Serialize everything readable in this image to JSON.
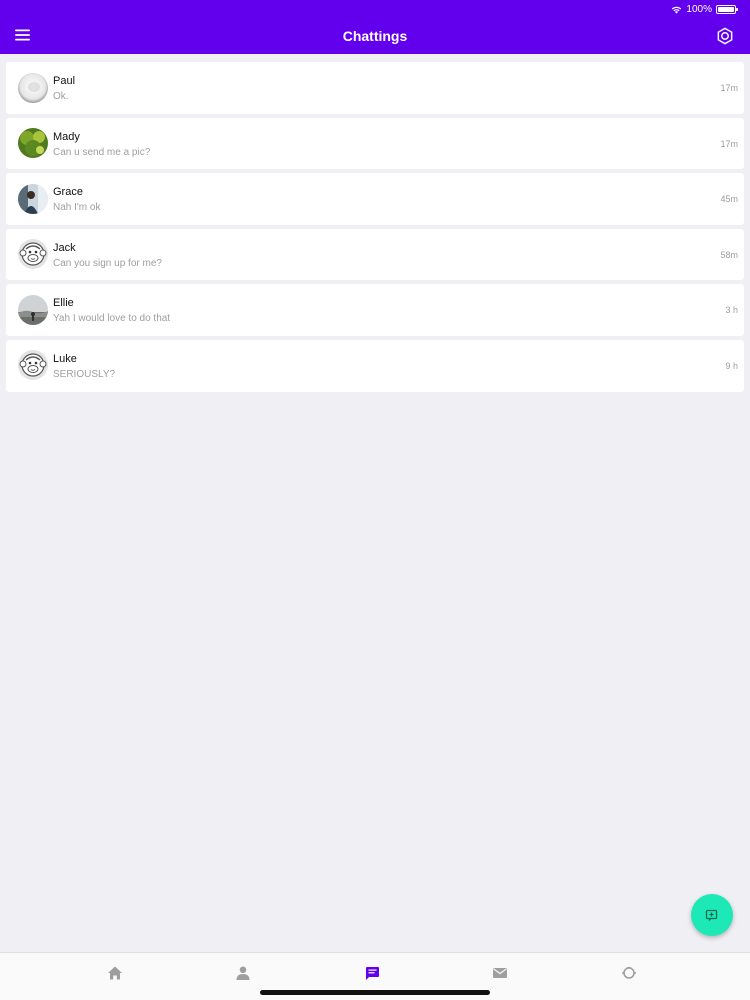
{
  "status_bar": {
    "battery_text": "100%"
  },
  "header": {
    "title": "Chattings",
    "background": "#6200ee",
    "menu_icon": "menu-icon",
    "settings_icon": "gear-icon"
  },
  "chats": [
    {
      "name": "Paul",
      "message": "Ok.",
      "time": "17m",
      "avatar": "photo-white"
    },
    {
      "name": "Mady",
      "message": "Can u send me a pic?",
      "time": "17m",
      "avatar": "photo-plant"
    },
    {
      "name": "Grace",
      "message": "Nah I'm ok",
      "time": "45m",
      "avatar": "photo-person"
    },
    {
      "name": "Jack",
      "message": "Can you sign up for me?",
      "time": "58m",
      "avatar": "default-monkey"
    },
    {
      "name": "Ellie",
      "message": "Yah I would love to do that",
      "time": "3 h",
      "avatar": "photo-outdoor"
    },
    {
      "name": "Luke",
      "message": "SERIOUSLY?",
      "time": "9 h",
      "avatar": "default-monkey"
    }
  ],
  "fab": {
    "icon": "new-chat-icon",
    "color": "#1de9b6"
  },
  "tabs": [
    {
      "icon": "home-icon",
      "active": false
    },
    {
      "icon": "person-icon",
      "active": false
    },
    {
      "icon": "chat-icon",
      "active": true
    },
    {
      "icon": "mail-icon",
      "active": false
    },
    {
      "icon": "explore-icon",
      "active": false
    }
  ],
  "colors": {
    "accent": "#6200ee",
    "inactive_tab": "#9e9e9e",
    "fab": "#1de9b6"
  }
}
